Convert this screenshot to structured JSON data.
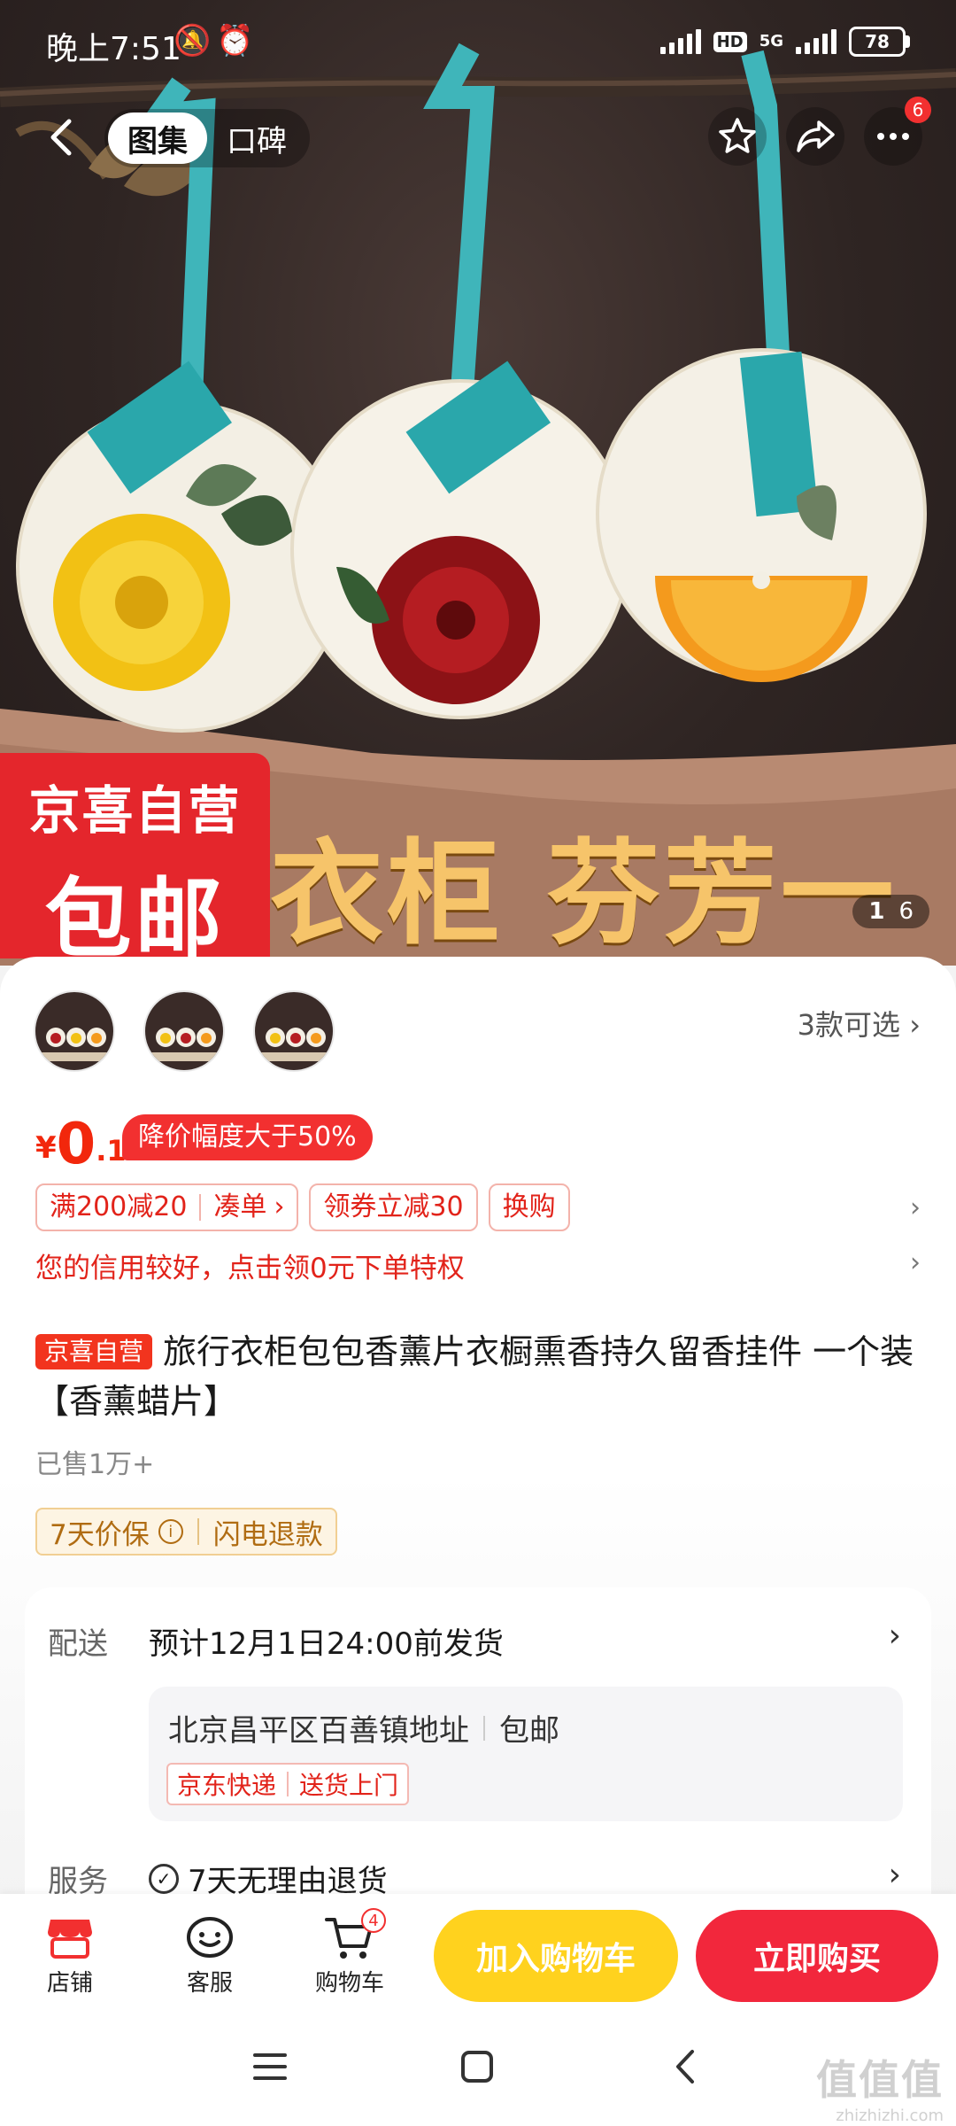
{
  "status": {
    "time": "晚上7:51",
    "icons": "🔕⏰",
    "hd": "HD",
    "net": "5G",
    "battery": "78"
  },
  "nav": {
    "tabs": [
      {
        "label": "图集",
        "active": true
      },
      {
        "label": "口碑",
        "active": false
      }
    ],
    "message_badge": "6"
  },
  "hero": {
    "promo_top": "京喜自营",
    "promo_bottom": "包邮",
    "slogan": "衣柜 芬芳一年",
    "pager_current": "1",
    "pager_total": "6"
  },
  "variants": {
    "count_label": "3款可选"
  },
  "price": {
    "symbol": "¥",
    "integer": "0",
    "decimal": ".1",
    "drop_tag": "降价幅度大于50%"
  },
  "coupons": {
    "full_reduction": "满200减20",
    "combine": "凑单",
    "combine_arrow": "›",
    "voucher": "领券立减30",
    "exchange": "换购"
  },
  "credit_text": "您的信用较好，点击领0元下单特权",
  "product": {
    "self_tag": "京喜自营",
    "title": "旅行衣柜包包香薰片衣橱熏香持久留香挂件 一个装【香薰蜡片】",
    "sold": "已售1万+",
    "guarantee_1": "7天价保",
    "guarantee_info": "i",
    "guarantee_2": "闪电退款"
  },
  "shipping": {
    "label": "配送",
    "estimate": "预计12月1日24:00前发货",
    "address": "北京昌平区百善镇地址",
    "free_shipping": "包邮",
    "express": "京东快递",
    "delivery": "送货上门"
  },
  "service": {
    "label": "服务",
    "text": "7天无理由退货"
  },
  "actions": {
    "shop": "店铺",
    "support": "客服",
    "cart": "购物车",
    "cart_count": "4",
    "add_to_cart": "加入购物车",
    "buy_now": "立即购买"
  },
  "watermark": {
    "big": "值值值",
    "small": "zhizhizhi.com"
  },
  "colors": {
    "accent_red": "#f2270c",
    "cart_yellow": "#ffd21e",
    "buy_red": "#f2273c",
    "ribbon_teal": "#3fb5ba"
  },
  "icons": {
    "back": "chevron-left-icon",
    "favorite": "star-icon",
    "share": "share-icon",
    "more": "more-icon",
    "shop": "shop-icon",
    "support": "chat-face-icon",
    "cart": "cart-icon"
  }
}
